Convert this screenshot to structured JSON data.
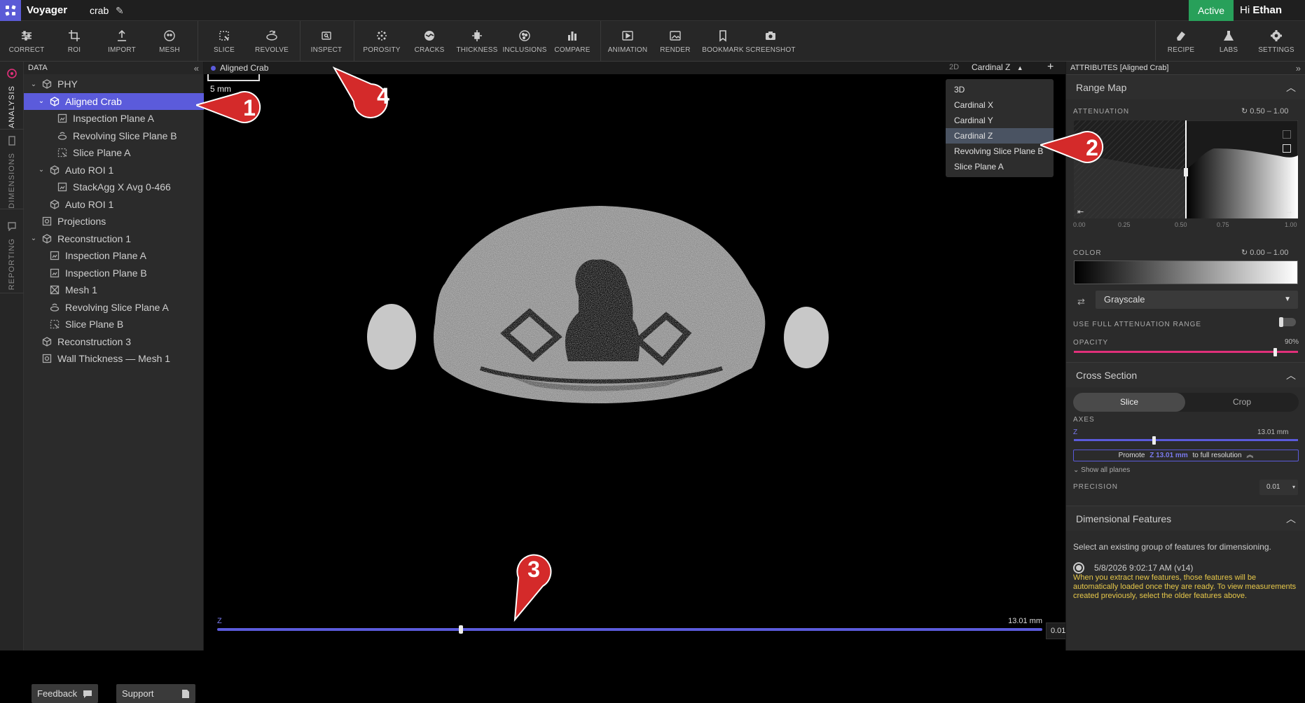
{
  "app": {
    "name": "Voyager",
    "project": "crab",
    "status": "Active",
    "greeting_prefix": "Hi",
    "user": "Ethan"
  },
  "toolbar": {
    "left": [
      "CORRECT",
      "ROI",
      "IMPORT",
      "MESH"
    ],
    "slice": [
      "SLICE",
      "REVOLVE"
    ],
    "inspect": [
      "INSPECT"
    ],
    "analysis": [
      "POROSITY",
      "CRACKS",
      "THICKNESS",
      "INCLUSIONS",
      "COMPARE"
    ],
    "output": [
      "ANIMATION",
      "RENDER",
      "BOOKMARK",
      "SCREENSHOT"
    ],
    "right": [
      "RECIPE",
      "LABS",
      "SETTINGS"
    ]
  },
  "rail": [
    "ANALYSIS",
    "DIMENSIONS",
    "REPORTING"
  ],
  "data_panel": {
    "title": "DATA",
    "tree": [
      {
        "label": "PHY",
        "depth": 0,
        "chevron": "open",
        "icon": "cube"
      },
      {
        "label": "Aligned Crab",
        "depth": 1,
        "chevron": "open",
        "icon": "cube",
        "selected": true
      },
      {
        "label": "Inspection Plane A",
        "depth": 2,
        "icon": "plane"
      },
      {
        "label": "Revolving Slice Plane B",
        "depth": 2,
        "icon": "revolve"
      },
      {
        "label": "Slice Plane A",
        "depth": 2,
        "icon": "slice"
      },
      {
        "label": "Auto ROI 1",
        "depth": 1,
        "chevron": "open",
        "icon": "cube"
      },
      {
        "label": "StackAgg X Avg 0-466",
        "depth": 2,
        "icon": "plane"
      },
      {
        "label": "Auto ROI 1",
        "depth": 1,
        "icon": "cube"
      },
      {
        "label": "Projections",
        "depth": 0,
        "icon": "proj"
      },
      {
        "label": "Reconstruction 1",
        "depth": 0,
        "chevron": "open",
        "icon": "cube"
      },
      {
        "label": "Inspection Plane A",
        "depth": 1,
        "icon": "plane"
      },
      {
        "label": "Inspection Plane B",
        "depth": 1,
        "icon": "plane"
      },
      {
        "label": "Mesh 1",
        "depth": 1,
        "icon": "mesh"
      },
      {
        "label": "Revolving Slice Plane A",
        "depth": 1,
        "icon": "revolve"
      },
      {
        "label": "Slice Plane B",
        "depth": 1,
        "icon": "slice"
      },
      {
        "label": "Reconstruction 3",
        "depth": 0,
        "icon": "cube"
      },
      {
        "label": "Wall Thickness — Mesh 1",
        "depth": 0,
        "icon": "proj"
      }
    ],
    "feedback": "Feedback",
    "support": "Support"
  },
  "viewport": {
    "title": "Aligned Crab",
    "mode": "2D",
    "view": "Cardinal Z",
    "scale": "5 mm",
    "views": [
      "3D",
      "Cardinal X",
      "Cardinal Y",
      "Cardinal Z",
      "Revolving Slice Plane B",
      "Slice Plane A"
    ],
    "selected_view": "Cardinal Z",
    "z_label": "Z",
    "z_value": "13.01 mm",
    "z_fraction": 0.295,
    "precision": "0.01"
  },
  "annotations": [
    "1",
    "2",
    "3",
    "4"
  ],
  "attributes": {
    "title": "ATTRIBUTES [Aligned Crab]",
    "range_map": {
      "title": "Range Map",
      "attenuation_label": "ATTENUATION",
      "attenuation_range": "0.50 – 1.00",
      "ticks": [
        "0.00",
        "0.25",
        "0.50",
        "0.75",
        "1.00"
      ],
      "color_label": "COLOR",
      "color_range": "0.00 – 1.00",
      "colormap": "Grayscale",
      "full_range_label": "USE FULL ATTENUATION RANGE",
      "opacity_label": "OPACITY",
      "opacity_value": "90%",
      "opacity": 0.9
    },
    "cross_section": {
      "title": "Cross Section",
      "tab_slice": "Slice",
      "tab_crop": "Crop",
      "axes_label": "AXES",
      "axis": "Z",
      "axis_value": "13.01 mm",
      "axis_fraction": 0.36,
      "promote_prefix": "Promote",
      "promote_value": "Z 13.01 mm",
      "promote_suffix": "to full resolution",
      "show_all": "Show all planes",
      "precision_label": "PRECISION",
      "precision": "0.01"
    },
    "dimensional": {
      "title": "Dimensional Features",
      "hint": "Select an existing group of features for dimensioning.",
      "option": "5/8/2026 9:02:17 AM (v14)",
      "note": "When you extract new features, those features will be automatically loaded once they are ready. To view measurements created previously, select the older features above."
    }
  },
  "colors": {
    "accent": "#5b5bdb",
    "active": "#28a05a",
    "marker": "#d42a2a",
    "opacity": "#e0307a",
    "note": "#e7c84a"
  }
}
